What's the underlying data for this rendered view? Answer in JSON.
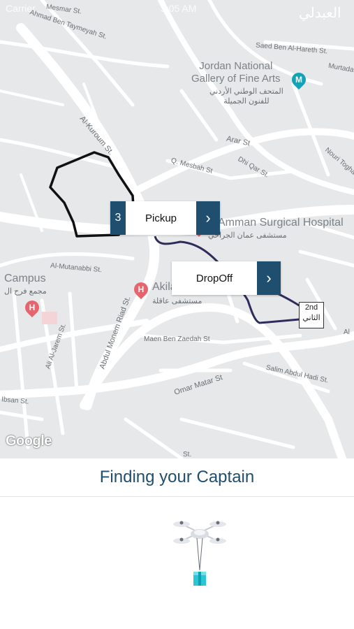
{
  "status_bar": {
    "carrier": "Carrier",
    "time": "3:05 AM"
  },
  "map": {
    "labels": [
      "Mesmar St.",
      "Ahmad Ben Taymeyah St.",
      "Saed Ben Al-Hareth St.",
      "Murtada",
      "Al-Kuroum St.",
      "Arar St",
      "Q. Mesbah St",
      "Dhi Qar St.",
      "Nouri Toghan St.",
      "Al-Mutanabbi St.",
      "Abdul Monem Riad St.",
      "Maen Ben Zaedah St",
      "Salim Abdul Hadi St.",
      "Omar Matar St",
      "Ali Al-Jarem St.",
      "Ibsan St.",
      "St.",
      "Al"
    ],
    "pois": {
      "gallery_en": "Jordan National\nGallery of Fine Arts",
      "gallery_ar": "المتحف الوطني الأردني\nللفنون الجميلة",
      "hospital_en": "Amman Surgical Hospital",
      "hospital_ar": "مستشفى عمان الجراحي",
      "akila_en": "Akila",
      "akila_ar": "مستشفى عاقلة",
      "campus_en": "Campus",
      "campus_ar": "مجمع فرح ال",
      "top_right_ar": "العبدلي"
    },
    "road_sign": {
      "line1": "2nd",
      "line2": "الثاني"
    },
    "google_logo": "Google",
    "colors": {
      "route": "#2e2c5a",
      "geofence": "#111111",
      "callout_accent": "#1f4e6e",
      "pin_red": "#e5646e",
      "pin_teal": "#12a3b6"
    }
  },
  "pickup_callout": {
    "number": "3",
    "label": "Pickup",
    "action_icon": "chevron-right-icon"
  },
  "dropoff_callout": {
    "label": "DropOff",
    "action_icon": "chevron-right-icon"
  },
  "finding": {
    "title": "Finding your Captain"
  },
  "loader": {
    "icon": "drone-delivery-icon"
  }
}
